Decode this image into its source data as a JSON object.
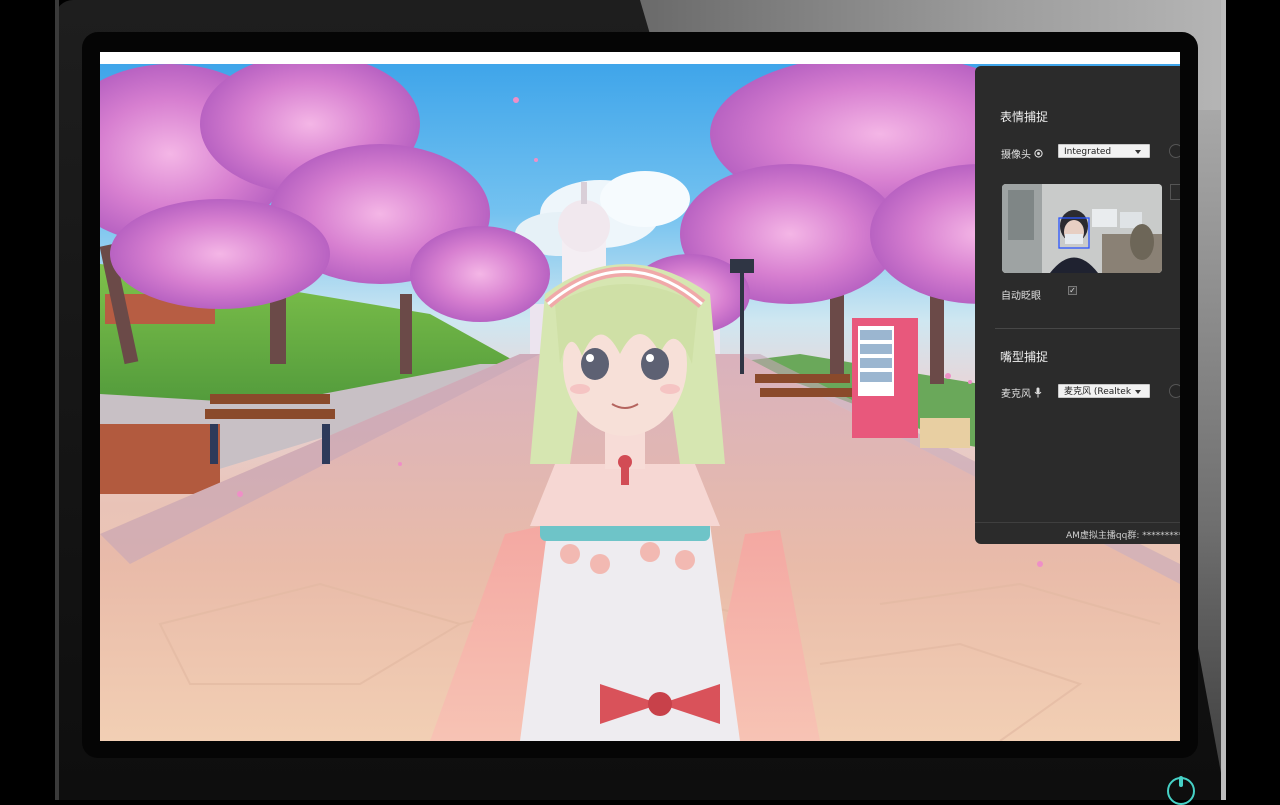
{
  "panel": {
    "expression_title": "表情捕捉",
    "camera_label": "摄像头",
    "camera_select": "Integrated",
    "auto_blink_label": "自动眨眼",
    "auto_blink_checked": true,
    "mouth_title": "嘴型捕捉",
    "mic_label": "麦克风",
    "mic_select": "麦克风 (Realtek",
    "footer": "AM虚拟主播qq群: **********"
  },
  "icons": {
    "camera_indicator": "webcam-icon",
    "mic_indicator": "microphone-icon",
    "power": "power-icon"
  },
  "colors": {
    "panel_bg": "#2b2b2b",
    "power_accent": "#46d1c6"
  }
}
